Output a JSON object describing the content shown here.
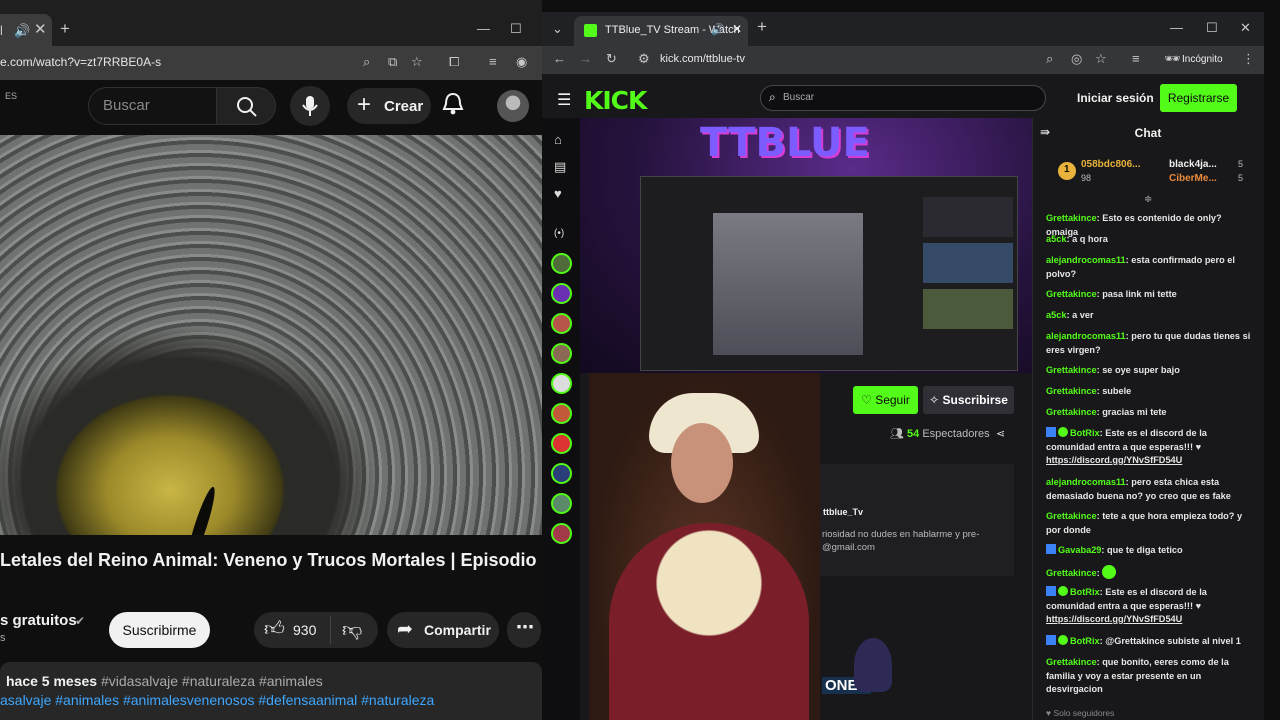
{
  "left_window": {
    "url": "e.com/watch?v=zt7RRBE0A-s",
    "locale_badge": "ES",
    "search_placeholder": "Buscar",
    "create_label": "Crear",
    "video_title": "Letales del Reino Animal: Veneno y Trucos Mortales | Episodio",
    "channel_name": "s gratuitos",
    "channel_subline": "s",
    "subscribe_label": "Suscribirme",
    "like_count": "930",
    "share_label": "Compartir",
    "desc_time": "hace 5 meses",
    "desc_tags_line1": "#vidasalvaje #naturaleza #animales",
    "desc_tags_line2": "asalvaje #animales #animalesvenenosos #defensaanimal #naturaleza"
  },
  "right_window": {
    "tab_title": "TTBlue_TV Stream - Watch",
    "url": "kick.com/ttblue-tv",
    "incognito_label": "Incógnito",
    "search_placeholder": "Buscar",
    "login_label": "Iniciar sesión",
    "register_label": "Registrarse",
    "stream_overlay_title": "TTBLUE",
    "follow_label": "Seguir",
    "subscribe_label": "Suscribirse",
    "viewers_count": "54",
    "viewers_label": "Espectadores",
    "about_name": "ttblue_Tv",
    "about_text": "riosidad no dudes en hablarme y pre-",
    "about_email": "@gmail.com",
    "ones_badge": "ONES"
  },
  "chat": {
    "title": "Chat",
    "top_gifters": [
      {
        "name": "058bdc806...",
        "sub": "98",
        "rank": "1"
      },
      {
        "name": "black4ja...",
        "count": "5"
      },
      {
        "name": "CiberMe...",
        "count": "5"
      }
    ],
    "messages": [
      {
        "user": "Grettakince",
        "text": "Esto es contenido de only? omaiga"
      },
      {
        "user": "a5ck",
        "text": "a q hora"
      },
      {
        "user": "alejandrocomas11",
        "text": "esta confirmado pero el polvo?"
      },
      {
        "user": "Grettakince",
        "text": "pasa link mi tette"
      },
      {
        "user": "a5ck",
        "text": "a ver"
      },
      {
        "user": "alejandrocomas11",
        "text": "pero tu que dudas tienes si eres virgen?"
      },
      {
        "user": "Grettakince",
        "text": "se oye super bajo"
      },
      {
        "user": "Grettakince",
        "text": "subele"
      },
      {
        "user": "Grettakince",
        "text": "gracias mi tete"
      },
      {
        "user": "BotRix",
        "text": "Este es el discord de la comunidad entra a que esperas!!! ♥",
        "link": "https://discord.gg/YNvSfFD54U"
      },
      {
        "user": "alejandrocomas11",
        "text": "pero esta chica esta demasiado buena no? yo creo que es fake"
      },
      {
        "user": "Grettakince",
        "text": "tete a que hora empieza todo? y por donde"
      },
      {
        "user": "Gavaba29",
        "text": "que te diga tetico"
      },
      {
        "user": "Grettakince",
        "text": ""
      },
      {
        "user": "BotRix",
        "text": "Este es el discord de la comunidad entra a que esperas!!! ♥",
        "link": "https://discord.gg/YNvSfFD54U"
      },
      {
        "user": "BotRix",
        "text": "@Grettakince subiste al nivel 1"
      },
      {
        "user": "Grettakince",
        "text": "que bonito, eeres como de la familia y voy a estar presente en un desvirgacion"
      }
    ],
    "footer": "Solo seguidores"
  }
}
